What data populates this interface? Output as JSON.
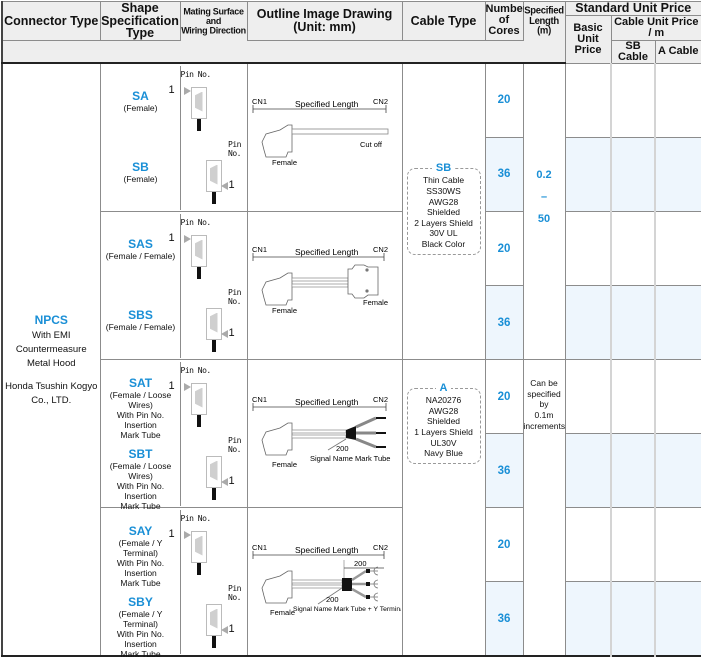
{
  "headers": {
    "connector_type": "Connector Type",
    "shape_spec_line1": "Shape",
    "shape_spec_line2": "Specification",
    "shape_spec_line3": "Type",
    "mating_line1": "Mating Surface and",
    "mating_line2": "Wiring Direction",
    "outline_line1": "Outline Image Drawing",
    "outline_line2": "(Unit: mm)",
    "cable_type": "Cable Type",
    "cores_line1": "Number",
    "cores_line2": "of",
    "cores_line3": "Cores",
    "length_line1": "Specified",
    "length_line2": "Length (m)",
    "standard_price": "Standard Unit Price",
    "basic_line1": "Basic",
    "basic_line2": "Unit Price",
    "cable_unit_price": "Cable Unit Price / m",
    "sb_cable": "SB Cable",
    "a_cable": "A Cable"
  },
  "connector": {
    "name": "NPCS",
    "desc_line1": "With EMI Countermeasure",
    "desc_line2": "Metal Hood",
    "maker_line1": "Honda Tsushin Kogyo",
    "maker_line2": "Co., LTD."
  },
  "mating": {
    "pin_label": "Pin No.",
    "pin_number": "1"
  },
  "groups": [
    {
      "rows": [
        {
          "code": "SA",
          "desc": [
            "(Female)"
          ],
          "cores": "20"
        },
        {
          "code": "SB",
          "desc": [
            "(Female)"
          ],
          "cores": "36"
        }
      ],
      "drawing": {
        "cn1": "CN1",
        "cn2": "CN2",
        "length": "Specified Length",
        "left_label": "Female",
        "right_label": "Cut off"
      }
    },
    {
      "rows": [
        {
          "code": "SAS",
          "desc": [
            "(Female / Female)"
          ],
          "cores": "20"
        },
        {
          "code": "SBS",
          "desc": [
            "(Female / Female)"
          ],
          "cores": "36"
        }
      ],
      "drawing": {
        "cn1": "CN1",
        "cn2": "CN2",
        "length": "Specified Length",
        "left_label": "Female",
        "right_label": "Female"
      }
    },
    {
      "rows": [
        {
          "code": "SAT",
          "desc": [
            "(Female / Loose Wires)",
            "With Pin No. Insertion",
            "Mark Tube"
          ],
          "cores": "20"
        },
        {
          "code": "SBT",
          "desc": [
            "(Female / Loose Wires)",
            "With Pin No. Insertion",
            "Mark Tube"
          ],
          "cores": "36"
        }
      ],
      "drawing": {
        "cn1": "CN1",
        "cn2": "CN2",
        "length": "Specified Length",
        "left_label": "Female",
        "dim": "200",
        "tube_label": "Signal Name Mark Tube"
      }
    },
    {
      "rows": [
        {
          "code": "SAY",
          "desc": [
            "(Female / Y Terminal)",
            "With Pin No. Insertion",
            "Mark Tube"
          ],
          "cores": "20"
        },
        {
          "code": "SBY",
          "desc": [
            "(Female / Y Terminal)",
            "With Pin No. Insertion",
            "Mark Tube"
          ],
          "cores": "36"
        }
      ],
      "drawing": {
        "cn1": "CN1",
        "cn2": "CN2",
        "length": "Specified Length",
        "left_label": "Female",
        "dim": "200",
        "dim2": "200",
        "tube_label": "Signal Name Mark Tube + Y Terminal"
      }
    }
  ],
  "cable_types": [
    {
      "title": "SB",
      "lines": [
        "Thin Cable",
        "SS30WS",
        "AWG28",
        "Shielded",
        "2 Layers Shield",
        "30V UL",
        "Black Color"
      ]
    },
    {
      "title": "A",
      "lines": [
        "NA20276",
        "AWG28",
        "Shielded",
        "1 Layers Shield",
        "UL30V",
        "Navy Blue"
      ]
    }
  ],
  "length": {
    "min": "0.2",
    "sep": "–",
    "max": "50",
    "note": [
      "Can be",
      "specified by",
      "0.1m",
      "increments"
    ]
  },
  "colors": {
    "accent": "#1a8fd6",
    "header_bg": "#eeeeee",
    "shaded_row": "#eef6fd"
  }
}
